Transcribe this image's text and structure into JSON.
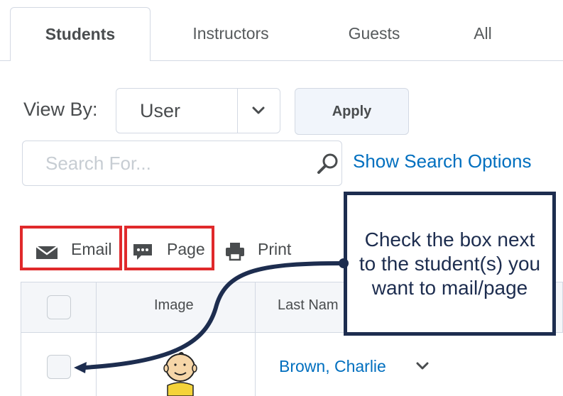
{
  "tabs": [
    {
      "label": "Students",
      "active": true
    },
    {
      "label": "Instructors",
      "active": false
    },
    {
      "label": "Guests",
      "active": false
    },
    {
      "label": "All",
      "active": false
    }
  ],
  "filters": {
    "view_by_label": "View By:",
    "view_by_value": "User",
    "apply_label": "Apply"
  },
  "search": {
    "placeholder": "Search For...",
    "value": "",
    "options_link": "Show Search Options"
  },
  "actions": {
    "email_label": "Email",
    "page_label": "Page",
    "print_label": "Print"
  },
  "table": {
    "columns": [
      "",
      "Image",
      "Last Nam"
    ],
    "rows": [
      {
        "name": "Brown, Charlie"
      }
    ]
  },
  "callout": {
    "text": "Check the box next to the student(s) you want to mail/page"
  },
  "colors": {
    "link": "#006fbf",
    "highlight": "#e0292b",
    "callout": "#1d2d4f"
  }
}
